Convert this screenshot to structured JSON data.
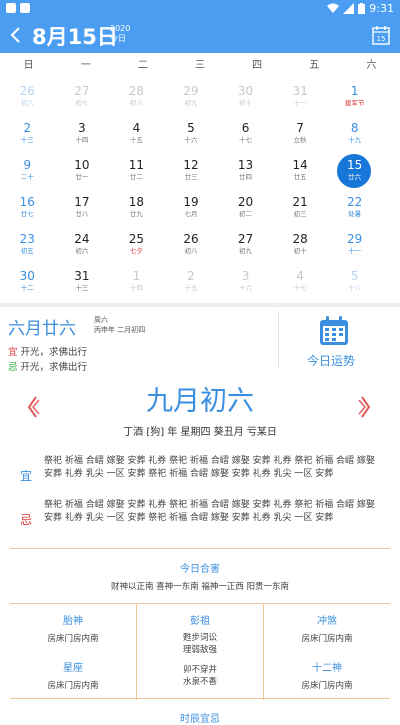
{
  "status_bar": {
    "time": "9:31"
  },
  "app_bar": {
    "title": "8月15日",
    "year": "2020",
    "today": "今日"
  },
  "weekdays": [
    "日",
    "一",
    "二",
    "三",
    "四",
    "五",
    "六"
  ],
  "calendar": [
    {
      "d": "26",
      "l": "初六",
      "dim": true
    },
    {
      "d": "27",
      "l": "初七",
      "dim": true
    },
    {
      "d": "28",
      "l": "初八",
      "dim": true
    },
    {
      "d": "29",
      "l": "初九",
      "dim": true
    },
    {
      "d": "30",
      "l": "初十",
      "dim": true
    },
    {
      "d": "31",
      "l": "十一",
      "dim": true
    },
    {
      "d": "1",
      "l": "建军节",
      "red": true
    },
    {
      "d": "2",
      "l": "十三"
    },
    {
      "d": "3",
      "l": "十四"
    },
    {
      "d": "4",
      "l": "十五"
    },
    {
      "d": "5",
      "l": "十六"
    },
    {
      "d": "6",
      "l": "十七"
    },
    {
      "d": "7",
      "l": "立秋"
    },
    {
      "d": "8",
      "l": "十九"
    },
    {
      "d": "9",
      "l": "二十"
    },
    {
      "d": "10",
      "l": "廿一"
    },
    {
      "d": "11",
      "l": "廿二"
    },
    {
      "d": "12",
      "l": "廿三"
    },
    {
      "d": "13",
      "l": "廿四"
    },
    {
      "d": "14",
      "l": "廿五"
    },
    {
      "d": "15",
      "l": "廿六",
      "sel": true
    },
    {
      "d": "16",
      "l": "廿七"
    },
    {
      "d": "17",
      "l": "廿八"
    },
    {
      "d": "18",
      "l": "廿九"
    },
    {
      "d": "19",
      "l": "七月"
    },
    {
      "d": "20",
      "l": "初二"
    },
    {
      "d": "21",
      "l": "初三"
    },
    {
      "d": "22",
      "l": "处暑"
    },
    {
      "d": "23",
      "l": "初五"
    },
    {
      "d": "24",
      "l": "初六"
    },
    {
      "d": "25",
      "l": "七夕",
      "red": true
    },
    {
      "d": "26",
      "l": "初八"
    },
    {
      "d": "27",
      "l": "初九"
    },
    {
      "d": "28",
      "l": "初十"
    },
    {
      "d": "29",
      "l": "十一"
    },
    {
      "d": "30",
      "l": "十二"
    },
    {
      "d": "31",
      "l": "十三"
    },
    {
      "d": "1",
      "l": "十四",
      "dim": true
    },
    {
      "d": "2",
      "l": "十五",
      "dim": true
    },
    {
      "d": "3",
      "l": "十六",
      "dim": true
    },
    {
      "d": "4",
      "l": "十七",
      "dim": true
    },
    {
      "d": "5",
      "l": "十八",
      "dim": true
    }
  ],
  "info": {
    "lunar_date": "六月廿六",
    "weekday": "周六",
    "ganzhi": "丙申年 二月初四",
    "yi_tag": "宜",
    "yi_text": "开光，求佛出行",
    "ji_tag": "忌",
    "ji_text": "开光，求佛出行",
    "fortune_label": "今日运势"
  },
  "almanac": {
    "big_date": "九月初六",
    "ganzhi_line": "丁酒 [狗] 年  星期四  葵丑月  亏某日",
    "yi_tag": "宜",
    "yi_text": "祭祀 祈福 合嶍 嫁娶 安葬 礼券 祭祀 祈福 合嶍 嫁娶 安葬 礼券 祭祀 祈福 合嶍 嫁娶 安葬 礼券 乳尖 一区 安葬 祭祀 祈福 合嶍 嫁娶 安葬 礼券 乳尖 一区 安葬",
    "ji_tag": "忌",
    "ji_text": "祭祀 祈福 合嶍 嫁娶 安葬 礼券 祭祀 祈福 合嶍 嫁娶 安葬 礼券 祭祀 祈福 合嶍 嫁娶 安葬 礼券 乳尖 一区 安葬 祭祀 祈福 合嶍 嫁娶 安葬 礼券 乳尖 一区 安葬",
    "hehai_title": "今日合害",
    "hehai_text": "财神以正南 喜神一东南 福神一正西 阳贵一东南",
    "taishen_title": "胎神",
    "taishen_text": "房床门房内南",
    "pengzu_title": "彭祖",
    "pengzu_text1": "甦步词讼",
    "pengzu_text2": "理弱敌强",
    "pengzu_text3": "卯不穿井",
    "pengzu_text4": "水泉不香",
    "chongsha_title": "冲煞",
    "chongsha_text": "房床门房内南",
    "xingzuo_title": "星座",
    "xingzuo_text": "房床门房内南",
    "shiershen_title": "十二神",
    "shiershen_text": "房床门房内南",
    "bottom_title": "时辰宜忌"
  }
}
